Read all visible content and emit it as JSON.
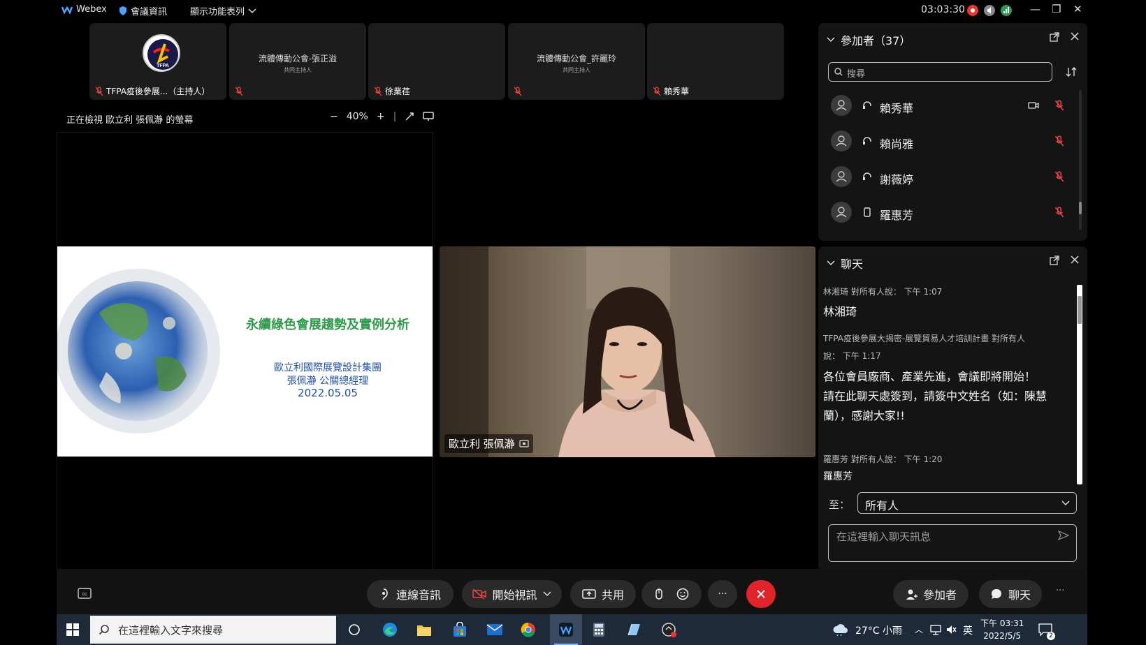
{
  "titlebar": {
    "app_name": "Webex",
    "meeting_info": "會議資訊",
    "show_menu": "顯示功能表列",
    "timer": "03:03:30"
  },
  "participants_strip": [
    {
      "name": "TFPA疫後參展...（主持人）",
      "logo_text": "TFPA"
    },
    {
      "name": "",
      "center": "流體傳動公會-張正溢",
      "sub": "共同主持人"
    },
    {
      "name": "徐業荏"
    },
    {
      "name": "",
      "center": "流體傳動公會_許麗玲",
      "sub": "共同主持人"
    },
    {
      "name": "賴秀華"
    }
  ],
  "share": {
    "header": "正在檢視 歐立利 張佩瀞 的螢幕",
    "zoom_minus": "−",
    "zoom_level": "40%",
    "zoom_plus": "+"
  },
  "slide": {
    "title": "永續綠色會展趨勢及實例分析",
    "line1": "歐立利國際展覽設計集團",
    "line2": "張佩瀞 公關總經理",
    "line3": "2022.05.05"
  },
  "video": {
    "name": "歐立利 張佩瀞"
  },
  "participants_panel": {
    "title": "參加者（37）",
    "search_placeholder": "搜尋",
    "rows": [
      {
        "name": "賴秀華"
      },
      {
        "name": "賴尚雅"
      },
      {
        "name": "謝薇婷"
      },
      {
        "name": "羅惠芳"
      }
    ]
  },
  "chat_panel": {
    "title": "聊天",
    "messages": [
      {
        "meta": "林湘琦 對所有人說：    下午 1:07",
        "lines": [
          "林湘琦"
        ]
      },
      {
        "meta": "TFPA疫後參展大揭密-展覽貿易人才培訓計畫 對所有人",
        "meta2": "說：    下午 1:17",
        "lines": [
          "各位會員廠商、產業先進，會議即將開始！",
          "請在此聊天處簽到，請簽中文姓名（如：陳慧",
          "蘭），感謝大家!!"
        ]
      },
      {
        "meta": "羅惠芳 對所有人說：    下午 1:20",
        "lines": [
          "羅惠芳"
        ]
      }
    ],
    "to_label": "至：",
    "to_value": "所有人",
    "input_placeholder": "在這裡輸入聊天訊息"
  },
  "controls": {
    "audio": "連線音訊",
    "video": "開始視訊",
    "share": "共用",
    "more": "···",
    "participants": "參加者",
    "chat": "聊天",
    "overflow": "···"
  },
  "taskbar": {
    "search_placeholder": "在這裡輸入文字來搜尋",
    "weather": "27°C 小雨",
    "ime": "英",
    "time": "下午 03:31",
    "date": "2022/5/5",
    "notifications": "2"
  },
  "colors": {
    "bg": "#000000",
    "panel": "#141414",
    "end_call": "#e0242a",
    "slide_title": "#2f9a4a",
    "slide_text": "#1f4ea6"
  }
}
